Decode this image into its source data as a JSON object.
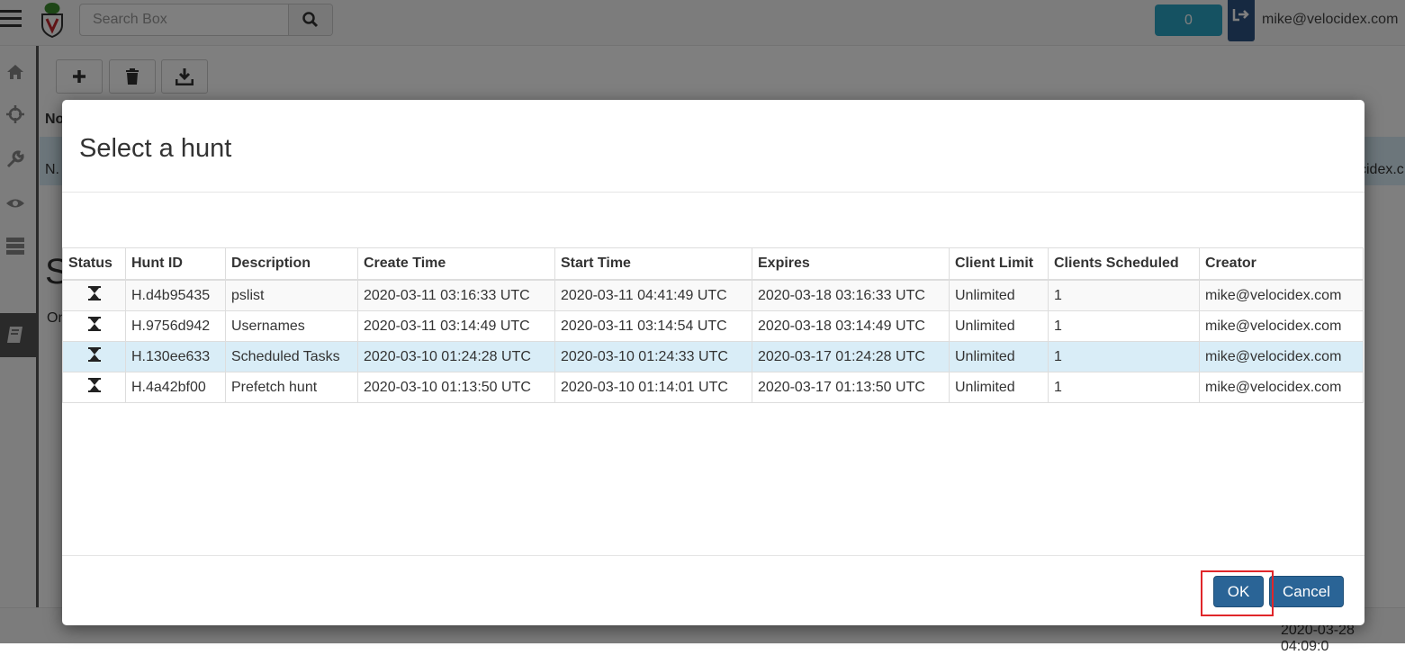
{
  "navbar": {
    "search_placeholder": "Search Box",
    "notification_count": "0",
    "user": "mike@velocidex.com"
  },
  "background": {
    "header_fragment": "No",
    "row_prefix": "N.",
    "row_suffix": "cidex.c",
    "s_fragment": "S",
    "on_fragment": "On",
    "footer_timestamp": "2020-03-28 04:09:0"
  },
  "modal": {
    "title": "Select a hunt",
    "columns": [
      "Status",
      "Hunt ID",
      "Description",
      "Create Time",
      "Start Time",
      "Expires",
      "Client Limit",
      "Clients Scheduled",
      "Creator"
    ],
    "rows": [
      {
        "status_icon": "hourglass-icon",
        "hunt_id": "H.d4b95435",
        "description": "pslist",
        "create_time": "2020-03-11 03:16:33 UTC",
        "start_time": "2020-03-11 04:41:49 UTC",
        "expires": "2020-03-18 03:16:33 UTC",
        "client_limit": "Unlimited",
        "clients_scheduled": "1",
        "creator": "mike@velocidex.com"
      },
      {
        "status_icon": "hourglass-icon",
        "hunt_id": "H.9756d942",
        "description": "Usernames",
        "create_time": "2020-03-11 03:14:49 UTC",
        "start_time": "2020-03-11 03:14:54 UTC",
        "expires": "2020-03-18 03:14:49 UTC",
        "client_limit": "Unlimited",
        "clients_scheduled": "1",
        "creator": "mike@velocidex.com"
      },
      {
        "status_icon": "hourglass-icon",
        "hunt_id": "H.130ee633",
        "description": "Scheduled Tasks",
        "create_time": "2020-03-10 01:24:28 UTC",
        "start_time": "2020-03-10 01:24:33 UTC",
        "expires": "2020-03-17 01:24:28 UTC",
        "client_limit": "Unlimited",
        "clients_scheduled": "1",
        "creator": "mike@velocidex.com"
      },
      {
        "status_icon": "hourglass-icon",
        "hunt_id": "H.4a42bf00",
        "description": "Prefetch hunt",
        "create_time": "2020-03-10 01:13:50 UTC",
        "start_time": "2020-03-10 01:14:01 UTC",
        "expires": "2020-03-17 01:13:50 UTC",
        "client_limit": "Unlimited",
        "clients_scheduled": "1",
        "creator": "mike@velocidex.com"
      }
    ],
    "selected_row": 2,
    "ok_label": "OK",
    "cancel_label": "Cancel"
  },
  "colors": {
    "primary_button": "#2a6496",
    "selected_row": "#d9edf7",
    "highlight_box": "#e0262a",
    "notification": "#2aa4c5"
  }
}
